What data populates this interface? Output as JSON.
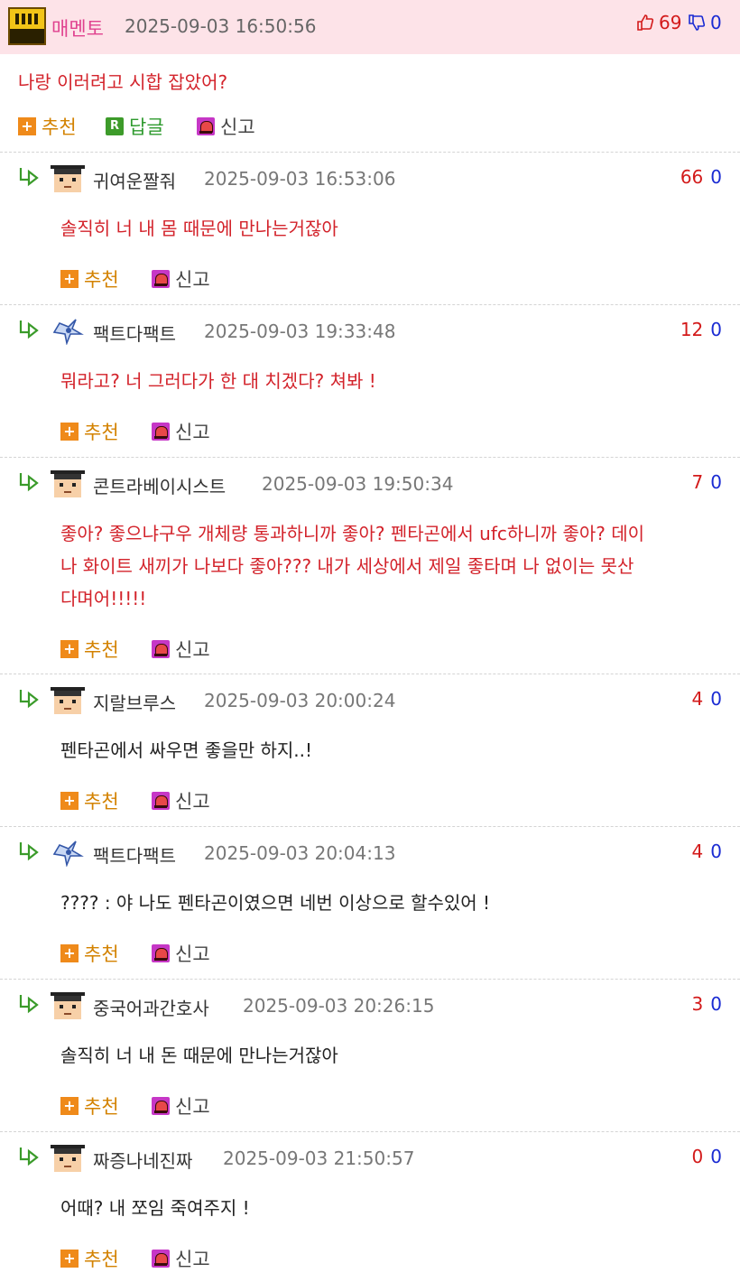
{
  "post": {
    "author": "매멘토",
    "datetime": "2025-09-03 16:50:56",
    "upvotes": "69",
    "downvotes": "0",
    "text": "나랑 이러려고 시합 잡았어?",
    "actions": {
      "recommend": "추천",
      "reply": "답글",
      "report": "신고"
    }
  },
  "colors": {
    "header_bg": "#fde3e8",
    "author": "#e0428f",
    "red_text": "#d3232b",
    "up": "#d31a1a",
    "down": "#1a2bd3",
    "recommend": "#d38200"
  },
  "comments": [
    {
      "author": "귀여운짤줘",
      "avatar": "mohawk-avatar",
      "datetime": "2025-09-03 16:53:06",
      "up": "66",
      "down": "0",
      "text": "솔직히 너 내 몸 때문에 만나는거잖아",
      "text_color": "red"
    },
    {
      "author": "팩트다팩트",
      "avatar": "ship-avatar",
      "datetime": "2025-09-03 19:33:48",
      "up": "12",
      "down": "0",
      "text": "뭐라고? 너 그러다가 한 대 치겠다? 쳐봐 !",
      "text_color": "red"
    },
    {
      "author": "콘트라베이시스트",
      "avatar": "mohawk-avatar",
      "datetime": "2025-09-03 19:50:34",
      "up": "7",
      "down": "0",
      "text_lines": [
        "좋아? 좋으냐구우 개체량 통과하니까 좋아? 펜타곤에서 ufc하니까 좋아? 데이",
        "나 화이트 새끼가 나보다 좋아??? 내가 세상에서 제일 좋타며 나 없이는 못산",
        "다며어!!!!!"
      ],
      "text_color": "red"
    },
    {
      "author": "지랄브루스",
      "avatar": "mohawk-avatar",
      "datetime": "2025-09-03 20:00:24",
      "up": "4",
      "down": "0",
      "text": "펜타곤에서 싸우면 좋을만 하지..!",
      "text_color": "black"
    },
    {
      "author": "팩트다팩트",
      "avatar": "ship-avatar",
      "datetime": "2025-09-03 20:04:13",
      "up": "4",
      "down": "0",
      "text": "???? : 야 나도 펜타곤이였으면 네번 이상으로 할수있어 !",
      "text_color": "black"
    },
    {
      "author": "중국어과간호사",
      "avatar": "mohawk-avatar",
      "datetime": "2025-09-03 20:26:15",
      "up": "3",
      "down": "0",
      "text": "솔직히 너 내 돈 때문에 만나는거잖아",
      "text_color": "black"
    },
    {
      "author": "짜증나네진짜",
      "avatar": "mohawk-avatar",
      "datetime": "2025-09-03 21:50:57",
      "up": "0",
      "down": "0",
      "text": "어때? 내 쪼임 죽여주지 !",
      "text_color": "black"
    }
  ],
  "comment_actions": {
    "recommend": "추천",
    "report": "신고"
  }
}
